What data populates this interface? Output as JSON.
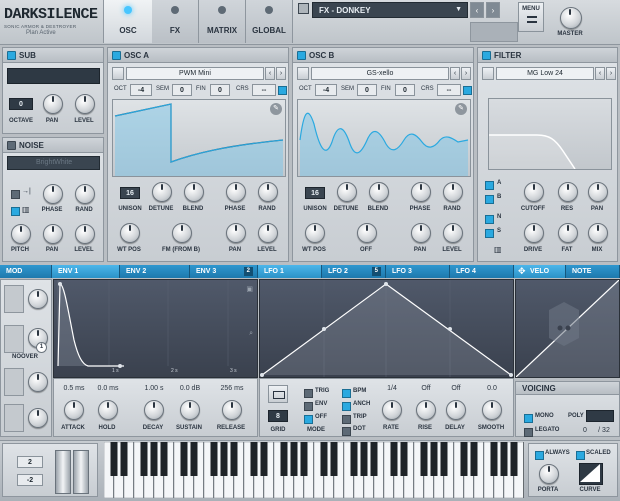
{
  "logo": {
    "title": "DARKSILENCE",
    "subtitle": "SONIC ARMOR & DESTROYER",
    "status": "Plan Active"
  },
  "top_tabs": [
    {
      "label": "OSC",
      "active": true
    },
    {
      "label": "FX",
      "active": false
    },
    {
      "label": "MATRIX",
      "active": false
    },
    {
      "label": "GLOBAL",
      "active": false
    }
  ],
  "preset": {
    "name": "FX - DONKEY"
  },
  "menu_label": "MENU",
  "master_label": "MASTER",
  "sub": {
    "title": "SUB",
    "octave_value": "0",
    "knob_labels": [
      "OCTAVE",
      "PAN",
      "LEVEL"
    ]
  },
  "noise": {
    "title": "NOISE",
    "type": "BrightWhite",
    "knob_labels_1": [
      "PHASE",
      "RAND"
    ],
    "knob_labels_2": [
      "PITCH",
      "PAN",
      "LEVEL"
    ]
  },
  "osc_a": {
    "title": "OSC A",
    "wavetable": "PWM Mini",
    "params": [
      {
        "k": "OCT",
        "v": "-4"
      },
      {
        "k": "SEM",
        "v": "0"
      },
      {
        "k": "FIN",
        "v": "0"
      },
      {
        "k": "CRS",
        "v": "--"
      }
    ],
    "unison": "16",
    "knob_labels_1": [
      "UNISON",
      "DETUNE",
      "BLEND",
      "PHASE",
      "RAND"
    ],
    "knob_labels_2": [
      "WT POS",
      "FM (FROM B)",
      "PAN",
      "LEVEL"
    ]
  },
  "osc_b": {
    "title": "OSC B",
    "wavetable": "GS-xello",
    "params": [
      {
        "k": "OCT",
        "v": "-4"
      },
      {
        "k": "SEM",
        "v": "0"
      },
      {
        "k": "FIN",
        "v": "0"
      },
      {
        "k": "CRS",
        "v": "--"
      }
    ],
    "unison": "16",
    "knob_labels_1": [
      "UNISON",
      "DETUNE",
      "BLEND",
      "PHASE",
      "RAND"
    ],
    "knob_labels_2": [
      "WT POS",
      "OFF",
      "PAN",
      "LEVEL"
    ]
  },
  "filter": {
    "title": "FILTER",
    "type": "MG Low 24",
    "routes": [
      "A",
      "B",
      "N",
      "S"
    ],
    "knob_labels_1": [
      "CUTOFF",
      "RES",
      "PAN"
    ],
    "knob_labels_2": [
      "DRIVE",
      "FAT",
      "MIX"
    ]
  },
  "mod_tabs": [
    {
      "label": "MOD"
    },
    {
      "label": "ENV 1",
      "sel": true
    },
    {
      "label": "ENV 2"
    },
    {
      "label": "ENV 3",
      "badge": "2"
    },
    {
      "label": "LFO 1",
      "sel": true
    },
    {
      "label": "LFO 2",
      "badge": "5"
    },
    {
      "label": "LFO 3"
    },
    {
      "label": "LFO 4"
    },
    {
      "label": "VELO",
      "sel": true
    },
    {
      "label": "NOTE"
    }
  ],
  "mod_side": {
    "noover": "NOOVER",
    "badge": "1"
  },
  "env": {
    "time_marks": [
      "1 s",
      "2 s",
      "3 s"
    ],
    "values": [
      "0.5 ms",
      "0.0 ms",
      "1.00 s",
      "0.0 dB",
      "256 ms"
    ],
    "knob_labels": [
      "ATTACK",
      "HOLD",
      "DECAY",
      "SUSTAIN",
      "RELEASE"
    ]
  },
  "lfo": {
    "grid": "8",
    "grid_label": "GRID",
    "mode_label": "MODE",
    "options_col1": [
      {
        "label": "TRIG",
        "on": false
      },
      {
        "label": "ENV",
        "on": false
      },
      {
        "label": "OFF",
        "on": true
      }
    ],
    "options_col2": [
      {
        "label": "BPM",
        "on": true
      },
      {
        "label": "ANCH",
        "on": true
      },
      {
        "label": "TRIP",
        "on": false
      },
      {
        "label": "DOT",
        "on": false
      }
    ],
    "values": [
      "1/4",
      "Off",
      "Off",
      "0.0"
    ],
    "knob_labels": [
      "RATE",
      "RISE",
      "DELAY",
      "SMOOTH"
    ]
  },
  "voicing": {
    "title": "VOICING",
    "mono": "MONO",
    "poly_label": "POLY",
    "legato": "LEGATO",
    "poly_value": "0",
    "poly_max": "/ 32"
  },
  "bend": {
    "up": "2",
    "down": "-2"
  },
  "porta": {
    "always": "ALWAYS",
    "scaled": "SCALED",
    "knob_labels": [
      "PORTA",
      "CURVE"
    ]
  },
  "colors": {
    "accent": "#2aa9e0",
    "panel": "#d5d9dd",
    "dark": "#2e3944"
  }
}
